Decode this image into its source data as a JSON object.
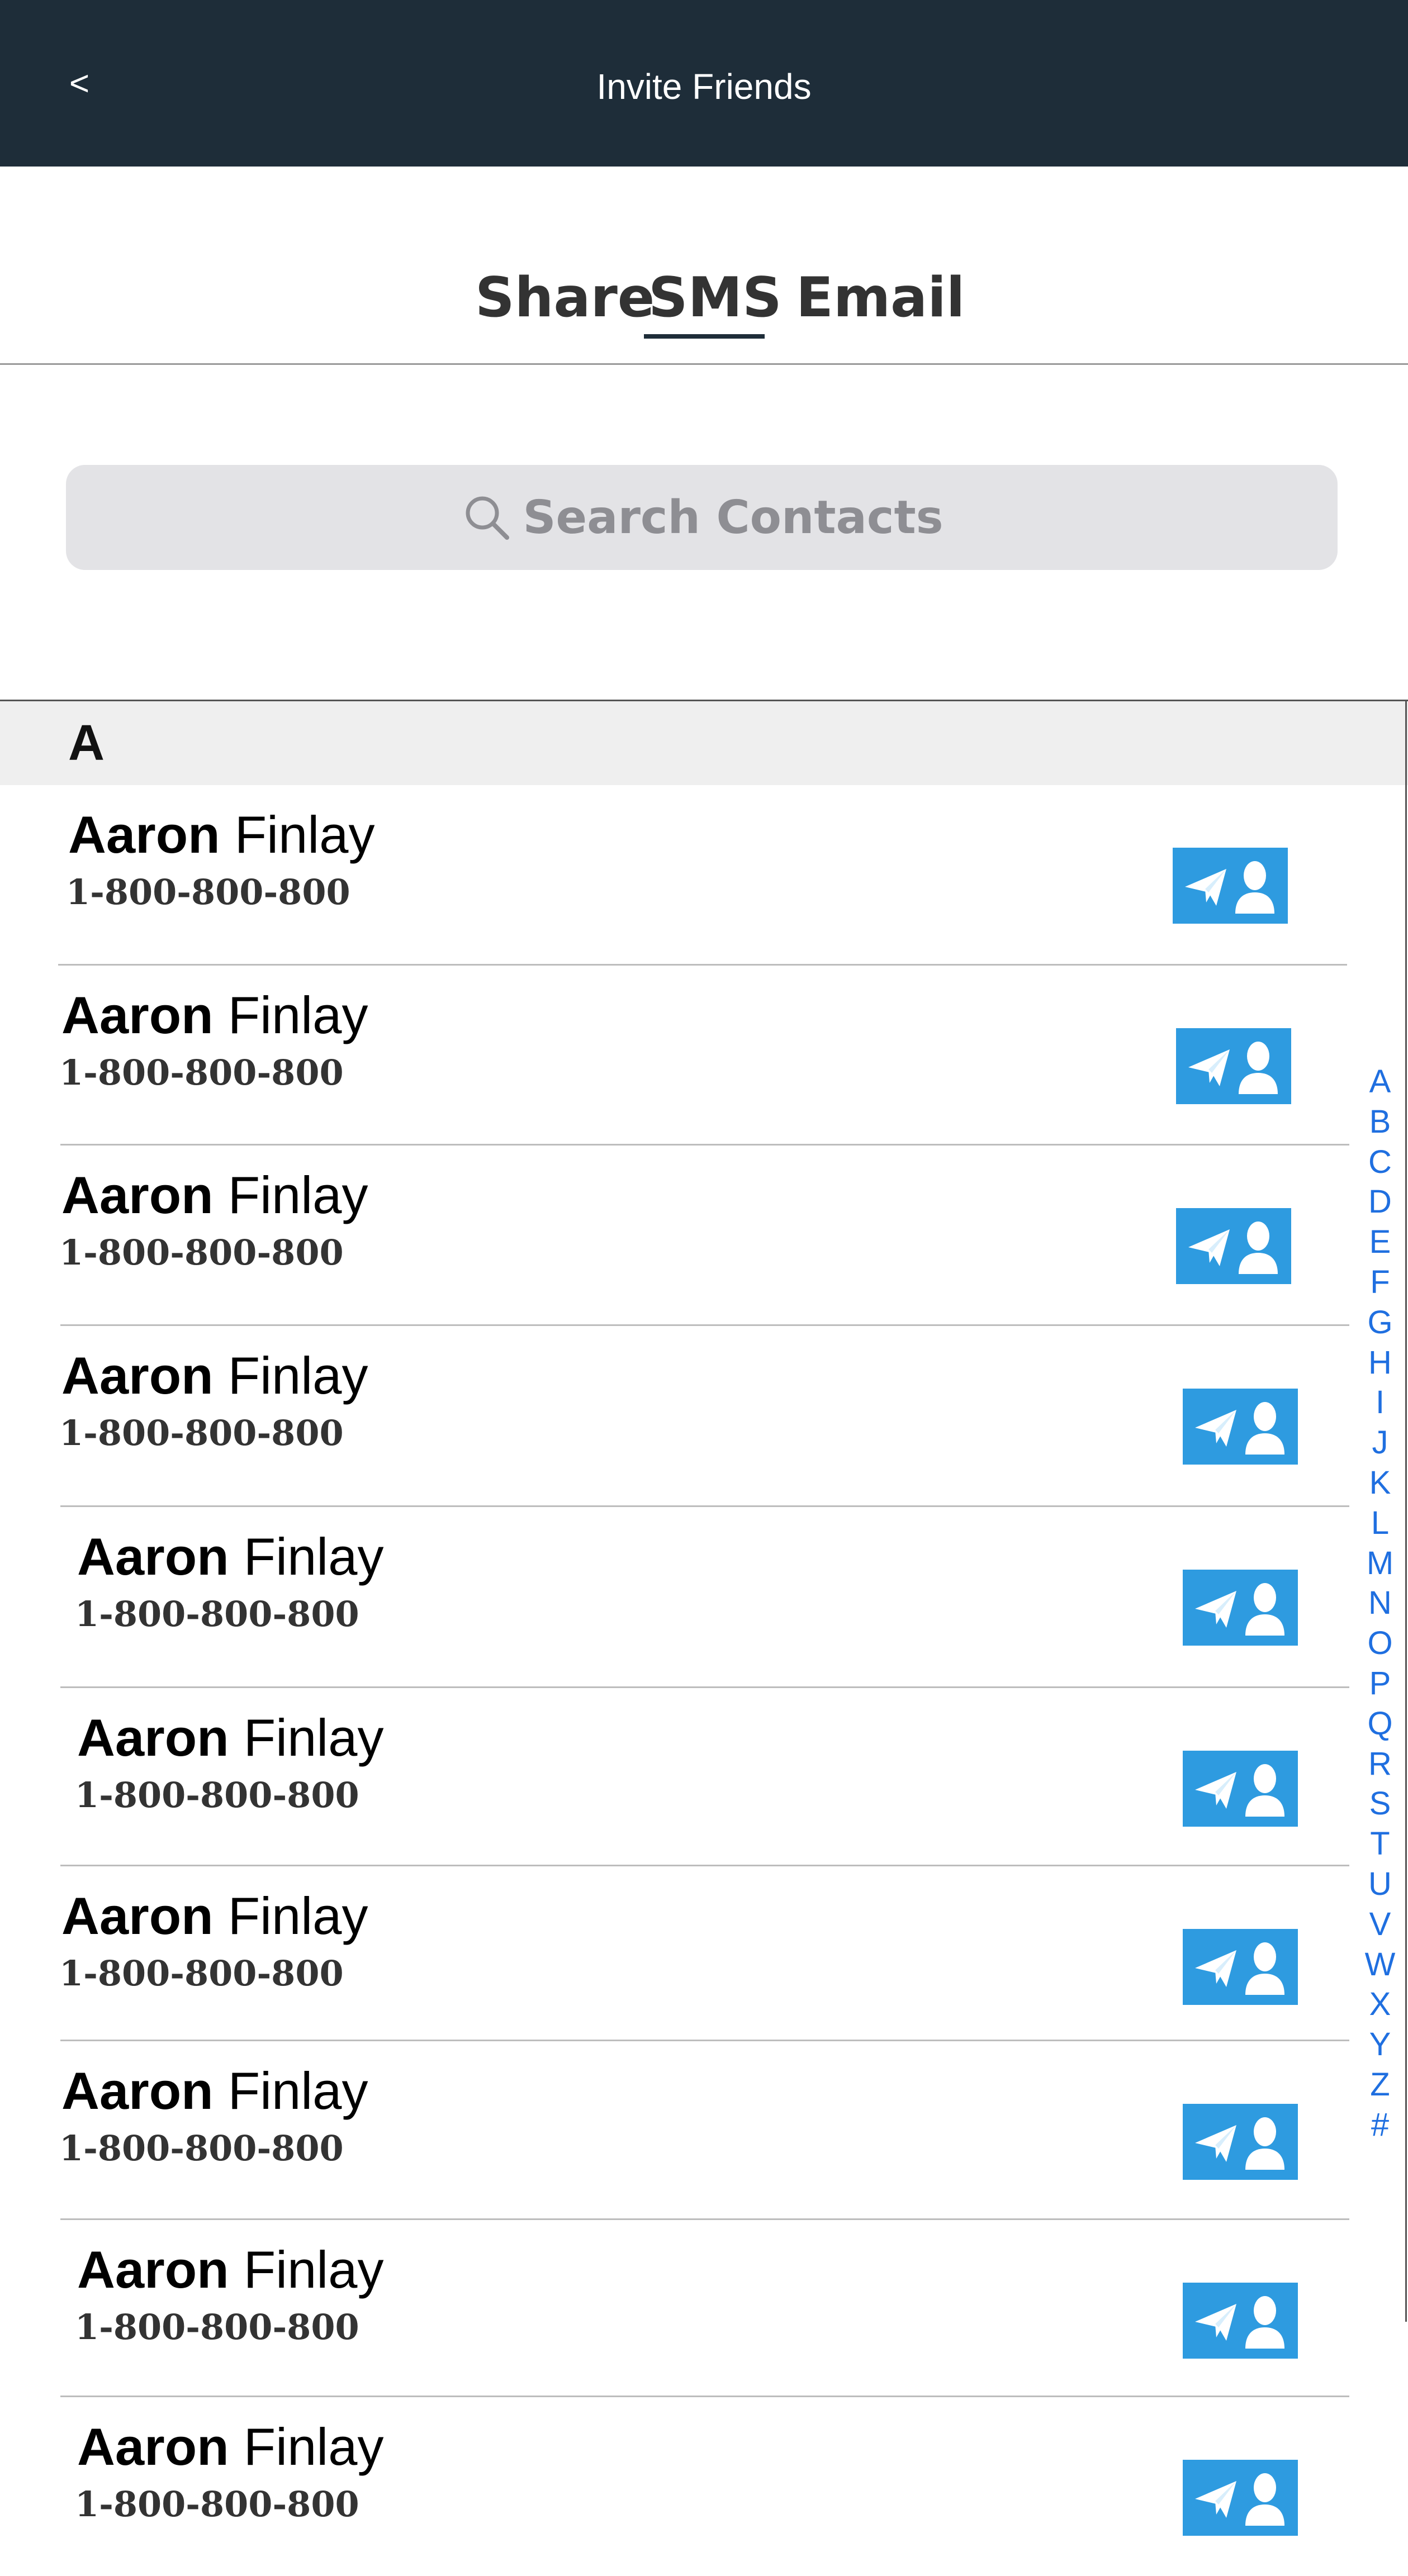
{
  "header": {
    "back_label": "<",
    "title": "Invite Friends"
  },
  "tabs": [
    {
      "label": "Share",
      "active": false
    },
    {
      "label": "SMS",
      "active": true
    },
    {
      "label": "Email",
      "active": false
    }
  ],
  "search": {
    "placeholder": "Search Contacts",
    "icon": "search-icon"
  },
  "section": {
    "letter": "A"
  },
  "contacts": [
    {
      "first": "Aaron",
      "last": "Finlay",
      "phone": "1-800-800-800"
    },
    {
      "first": "Aaron",
      "last": "Finlay",
      "phone": "1-800-800-800"
    },
    {
      "first": "Aaron",
      "last": "Finlay",
      "phone": "1-800-800-800"
    },
    {
      "first": "Aaron",
      "last": "Finlay",
      "phone": "1-800-800-800"
    },
    {
      "first": "Aaron",
      "last": "Finlay",
      "phone": "1-800-800-800"
    },
    {
      "first": "Aaron",
      "last": "Finlay",
      "phone": "1-800-800-800"
    },
    {
      "first": "Aaron",
      "last": "Finlay",
      "phone": "1-800-800-800"
    },
    {
      "first": "Aaron",
      "last": "Finlay",
      "phone": "1-800-800-800"
    },
    {
      "first": "Aaron",
      "last": "Finlay",
      "phone": "1-800-800-800"
    },
    {
      "first": "Aaron",
      "last": "Finlay",
      "phone": "1-800-800-800"
    }
  ],
  "invite_button_icon": "send-invite-icon",
  "alphabet": [
    "A",
    "B",
    "C",
    "D",
    "E",
    "F",
    "G",
    "H",
    "I",
    "J",
    "K",
    "L",
    "M",
    "N",
    "O",
    "P",
    "Q",
    "R",
    "S",
    "T",
    "U",
    "V",
    "W",
    "X",
    "Y",
    "Z",
    "#"
  ],
  "colors": {
    "header_bg": "#1e2d39",
    "accent": "#2e9be0",
    "index_blue": "#1f6fe0"
  }
}
